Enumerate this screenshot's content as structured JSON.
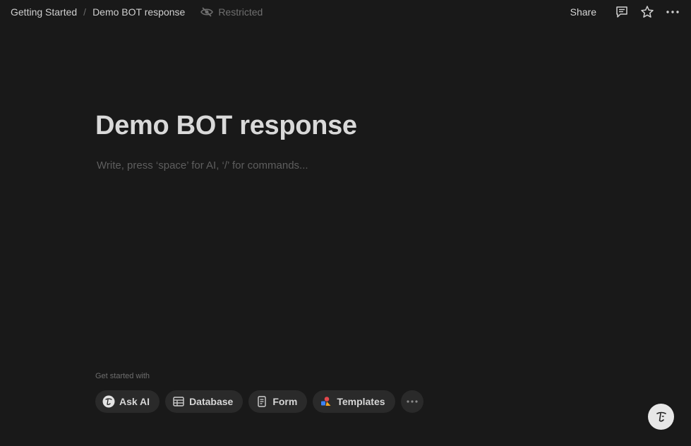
{
  "breadcrumb": {
    "items": [
      "Getting Started",
      "Demo BOT response"
    ],
    "separator": "/",
    "restricted_label": "Restricted"
  },
  "header": {
    "share_label": "Share",
    "icons": [
      "comment-icon",
      "star-icon",
      "more-icon"
    ]
  },
  "page": {
    "title": "Demo BOT response",
    "placeholder": "Write, press ‘space’ for AI, ‘/’ for commands..."
  },
  "get_started": {
    "label": "Get started with",
    "options": [
      {
        "label": "Ask AI",
        "icon": "ai-face-icon"
      },
      {
        "label": "Database",
        "icon": "table-icon"
      },
      {
        "label": "Form",
        "icon": "form-icon"
      },
      {
        "label": "Templates",
        "icon": "templates-icon"
      }
    ]
  },
  "colors": {
    "background": "#191919",
    "chip_background": "#2a2a2a",
    "fab_background": "#e7e7e7"
  }
}
